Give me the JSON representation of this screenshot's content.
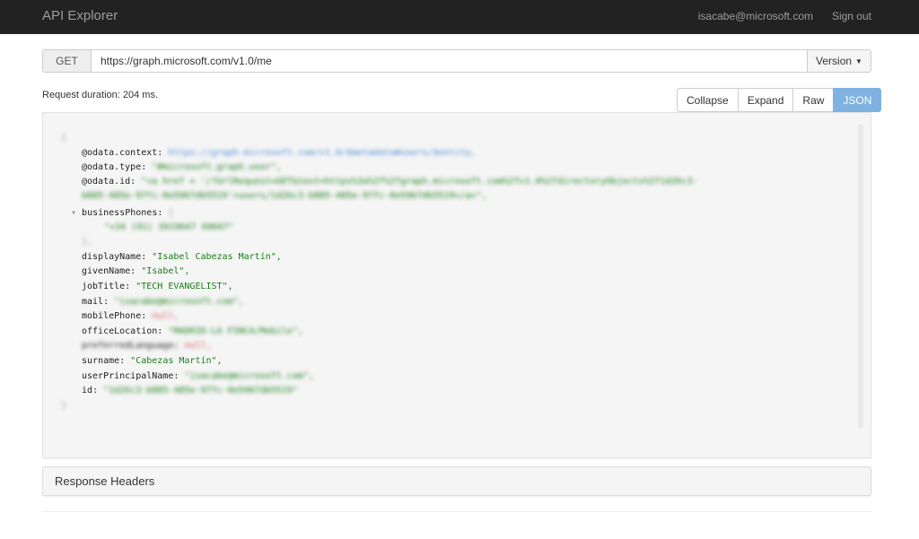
{
  "header": {
    "title": "API Explorer",
    "user_email": "isacabe@microsoft.com",
    "sign_out": "Sign out"
  },
  "request": {
    "method": "GET",
    "url": "https://graph.microsoft.com/v1.0/me",
    "version_label": "Version"
  },
  "duration_text": "Request duration: 204 ms.",
  "view_tabs": [
    {
      "label": "Collapse",
      "active": false
    },
    {
      "label": "Expand",
      "active": false
    },
    {
      "label": "Raw",
      "active": false
    },
    {
      "label": "JSON",
      "active": true
    }
  ],
  "json_view": {
    "open_brace": "{",
    "close_brace": "}",
    "odata_context_key": "@odata.context:",
    "odata_context_val": "https://graph.microsoft.com/v1.0/$metadata#users/$entity,",
    "odata_type_key": "@odata.type:",
    "odata_type_val": "\"#microsoft.graph.user\",",
    "odata_id_key": "@odata.id:",
    "odata_id_val1": "\"<a href = '/?UrlRequest=GET&text=https%3a%2f%2fgraph.microsoft.com%2fv1.0%2fdirectoryObjects%2f1d26c3-",
    "odata_id_val2": "b885-485e-97fc-0e5967db5519'>users/1d26c3-b885-485e-97fc-0e5967db5519</a>\",",
    "business_phones_key": "businessPhones:",
    "business_phones_open": "[",
    "business_phones_item": "\"+34 (91) 3919047 X9047\"",
    "business_phones_close": "],",
    "display_name_key": "displayName:",
    "display_name_val": "\"Isabel Cabezas Martín\",",
    "given_name_key": "givenName:",
    "given_name_val": "\"Isabel\",",
    "job_title_key": "jobTitle:",
    "job_title_val": "\"TECH EVANGELIST\",",
    "mail_key": "mail:",
    "mail_val": "\"isacabe@microsoft.com\",",
    "mobile_phone_key": "mobilePhone:",
    "mobile_phone_val": "null,",
    "office_location_key": "officeLocation:",
    "office_location_val": "\"MADRID-LA FINCA/Mobile\",",
    "preferred_language_key": "preferredLanguage:",
    "preferred_language_val": "null,",
    "surname_key": "surname:",
    "surname_val": "\"Cabezas Martín\",",
    "upn_key": "userPrincipalName:",
    "upn_val": "\"isacabe@microsoft.com\",",
    "id_key": "id:",
    "id_val": "\"1d26c3-b885-485e-97fc-0e5967db5519\""
  },
  "response_headers_label": "Response Headers",
  "colors": {
    "topbar": "#222222",
    "active_tab": "#7fb2e0",
    "json_string": "#1a7d1a",
    "json_null": "#d9534f",
    "json_link": "#4a8bd6"
  }
}
